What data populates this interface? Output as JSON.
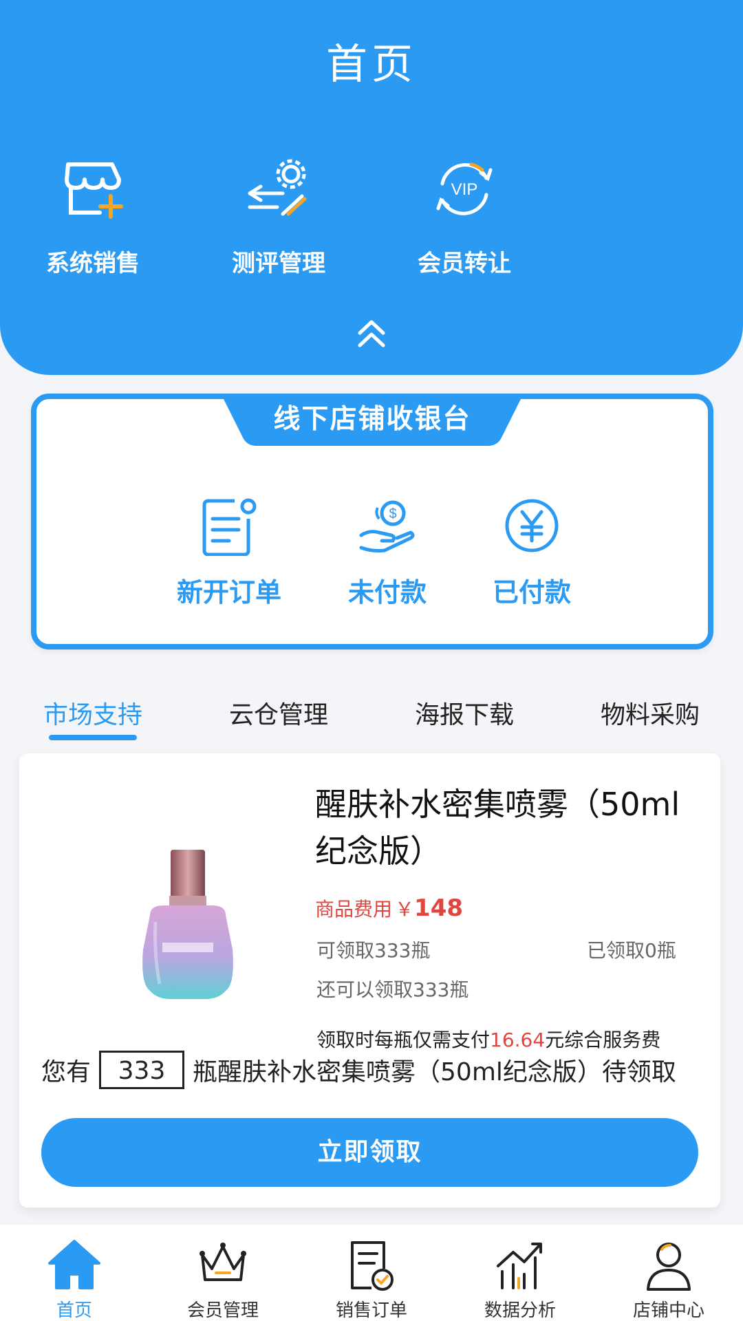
{
  "header": {
    "title": "首页",
    "quick_actions": [
      {
        "label": "系统销售",
        "icon": "store-add-icon"
      },
      {
        "label": "测评管理",
        "icon": "settings-flow-icon"
      },
      {
        "label": "会员转让",
        "icon": "vip-transfer-icon"
      }
    ],
    "collapse_icon": "double-chevron-up-icon"
  },
  "cashier": {
    "title": "线下店铺收银台",
    "items": [
      {
        "label": "新开订单",
        "icon": "new-order-icon"
      },
      {
        "label": "未付款",
        "icon": "unpaid-hand-coin-icon"
      },
      {
        "label": "已付款",
        "icon": "paid-yen-icon"
      }
    ]
  },
  "tabs": [
    {
      "label": "市场支持",
      "active": true
    },
    {
      "label": "云仓管理",
      "active": false
    },
    {
      "label": "海报下载",
      "active": false
    },
    {
      "label": "物料采购",
      "active": false
    }
  ],
  "product": {
    "name": "醒肤补水密集喷雾（50ml纪念版）",
    "price_label": "商品费用",
    "currency": "￥",
    "price": "148",
    "available": "可领取333瓶",
    "claimed": "已领取0瓶",
    "remaining": "还可以领取333瓶",
    "fee_prefix": "领取时每瓶仅需支付",
    "fee_amount": "16.64",
    "fee_suffix": "元综合服务费",
    "notice_prefix": "您有",
    "notice_qty": "333",
    "notice_suffix": "瓶醒肤补水密集喷雾（50ml纪念版）待领取",
    "claim_button": "立即领取"
  },
  "bottom_nav": [
    {
      "label": "首页",
      "icon": "home-icon",
      "active": true
    },
    {
      "label": "会员管理",
      "icon": "crown-icon",
      "active": false
    },
    {
      "label": "销售订单",
      "icon": "order-check-icon",
      "active": false
    },
    {
      "label": "数据分析",
      "icon": "chart-trend-icon",
      "active": false
    },
    {
      "label": "店铺中心",
      "icon": "user-icon",
      "active": false
    }
  ],
  "colors": {
    "primary": "#2b9af3",
    "price_red": "#e0453e",
    "background": "#f4f5f8"
  }
}
